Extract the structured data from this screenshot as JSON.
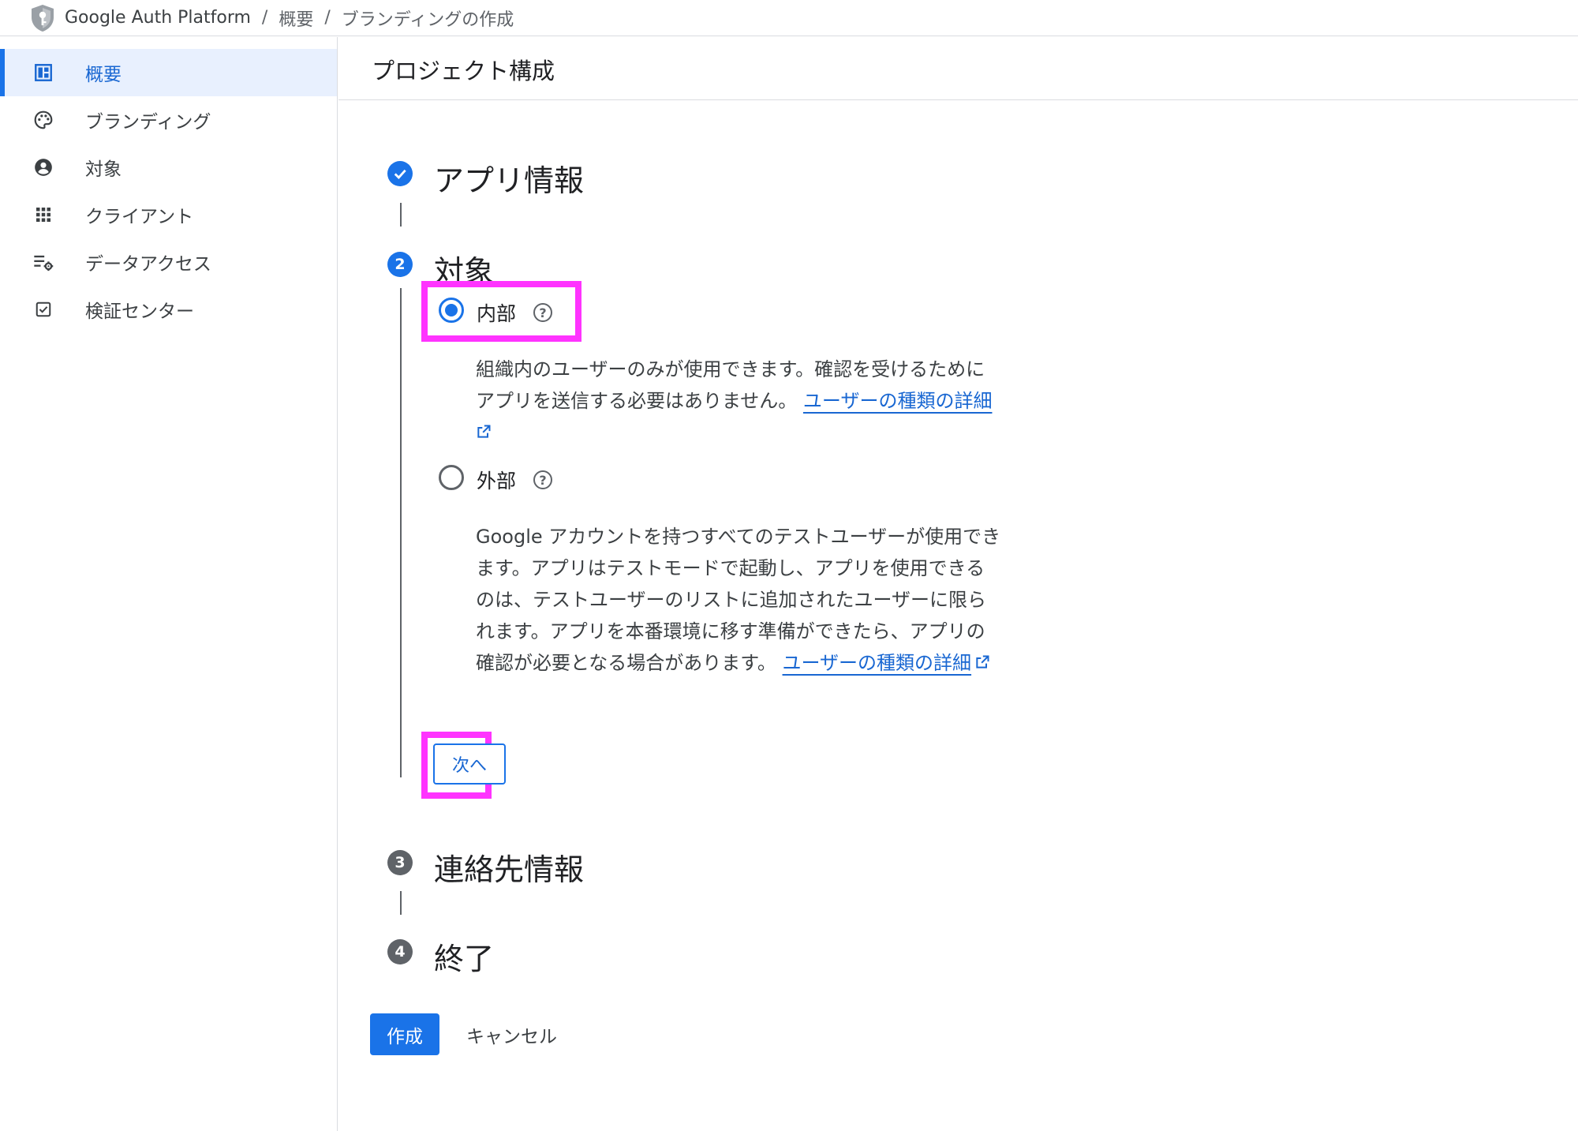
{
  "breadcrumb": {
    "items": [
      "Google Auth Platform",
      "概要",
      "ブランディングの作成"
    ],
    "separator": "/"
  },
  "sidebar": {
    "items": [
      {
        "label": "概要",
        "icon": "dashboard-icon",
        "active": true
      },
      {
        "label": "ブランディング",
        "icon": "palette-icon"
      },
      {
        "label": "対象",
        "icon": "account-circle-icon"
      },
      {
        "label": "クライアント",
        "icon": "apps-grid-icon"
      },
      {
        "label": "データアクセス",
        "icon": "data-settings-icon"
      },
      {
        "label": "検証センター",
        "icon": "checkbox-icon"
      }
    ]
  },
  "page": {
    "title": "プロジェクト構成"
  },
  "stepper": {
    "steps": [
      {
        "number": "1",
        "title": "アプリ情報",
        "state": "done"
      },
      {
        "number": "2",
        "title": "対象",
        "state": "current"
      },
      {
        "number": "3",
        "title": "連絡先情報",
        "state": "pending"
      },
      {
        "number": "4",
        "title": "終了",
        "state": "pending"
      }
    ]
  },
  "audience": {
    "selected": "internal",
    "internal": {
      "label": "内部",
      "desc_line1": "組織内のユーザーのみが使用できます。確認を受けるために",
      "desc_line2": "アプリを送信する必要はありません。",
      "link": "ユーザーの種類の詳細"
    },
    "external": {
      "label": "外部",
      "desc_line1": "Google アカウントを持つすべてのテストユーザーが使用でき",
      "desc_line2": "ます。アプリはテストモードで起動し、アプリを使用できる",
      "desc_line3": "のは、テストユーザーのリストに追加されたユーザーに限ら",
      "desc_line4": "れます。アプリを本番環境に移す準備ができたら、アプリの",
      "desc_line5": "確認が必要となる場合があります。",
      "link": "ユーザーの種類の詳細"
    },
    "help_glyph": "?"
  },
  "actions": {
    "next_label": "次へ",
    "create_label": "作成",
    "cancel_label": "キャンセル"
  },
  "colors": {
    "accent": "#1a73e8",
    "highlight": "#ff33ff",
    "active_nav_bg": "#e8f0fe"
  }
}
